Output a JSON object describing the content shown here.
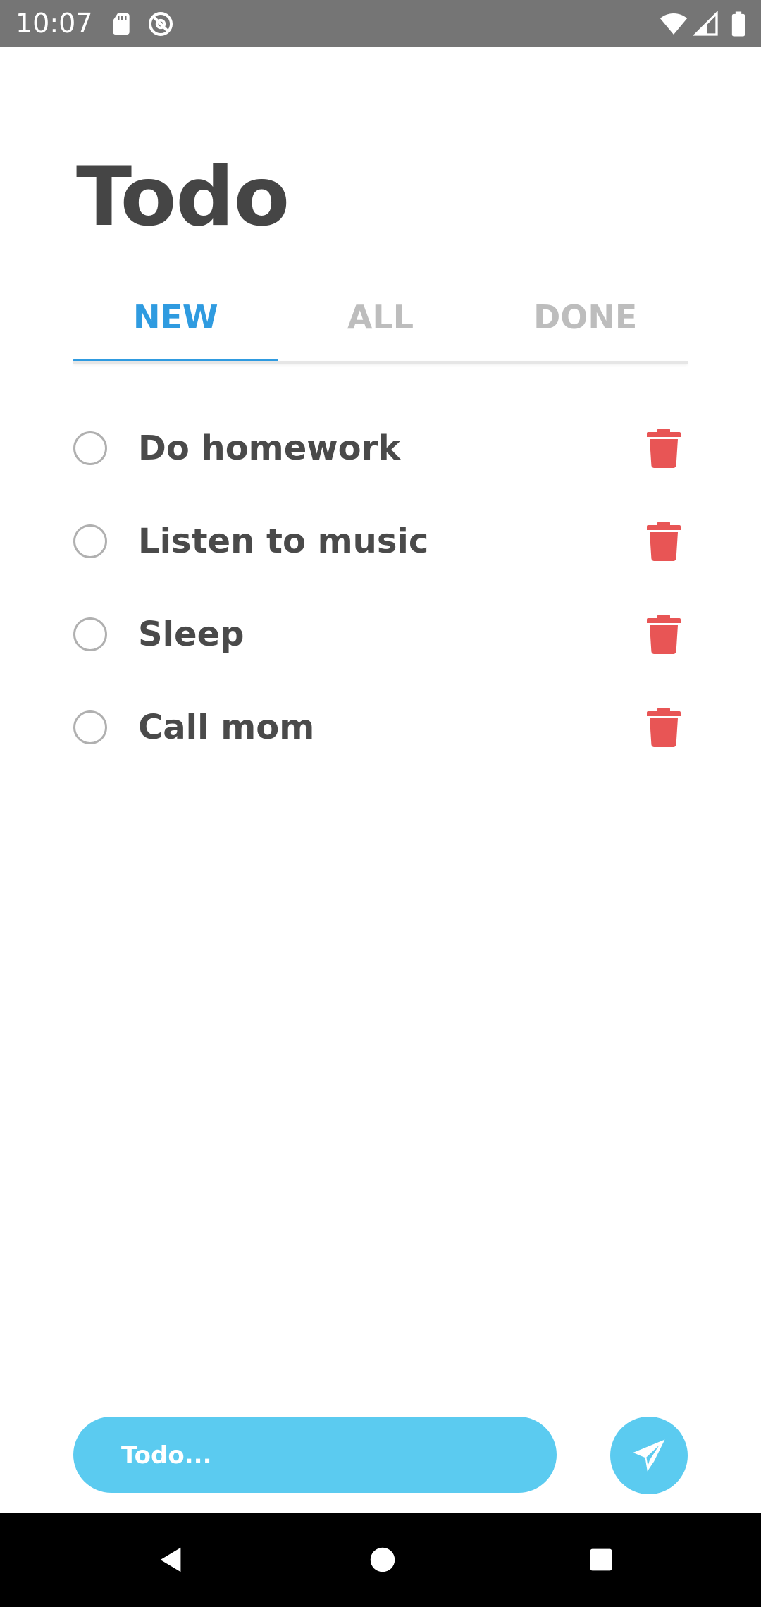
{
  "status_bar": {
    "time": "10:07",
    "icons": [
      "sd-card-icon",
      "do-not-disturb-icon",
      "wifi-icon",
      "cellular-signal-icon",
      "battery-icon"
    ]
  },
  "title": "Todo",
  "tabs": [
    {
      "label": "NEW",
      "active": true
    },
    {
      "label": "ALL",
      "active": false
    },
    {
      "label": "DONE",
      "active": false
    }
  ],
  "todos": [
    {
      "text": "Do homework",
      "done": false
    },
    {
      "text": "Listen to music",
      "done": false
    },
    {
      "text": "Sleep",
      "done": false
    },
    {
      "text": "Call mom",
      "done": false
    }
  ],
  "input": {
    "placeholder": "Todo...",
    "value": ""
  },
  "colors": {
    "accent": "#2f9be0",
    "input_bg": "#5bcbf0",
    "delete": "#e85555",
    "title": "#454545",
    "inactive_tab": "#bdbdbd"
  },
  "nav_bar": {
    "buttons": [
      "back-icon",
      "home-icon",
      "recents-icon"
    ]
  }
}
